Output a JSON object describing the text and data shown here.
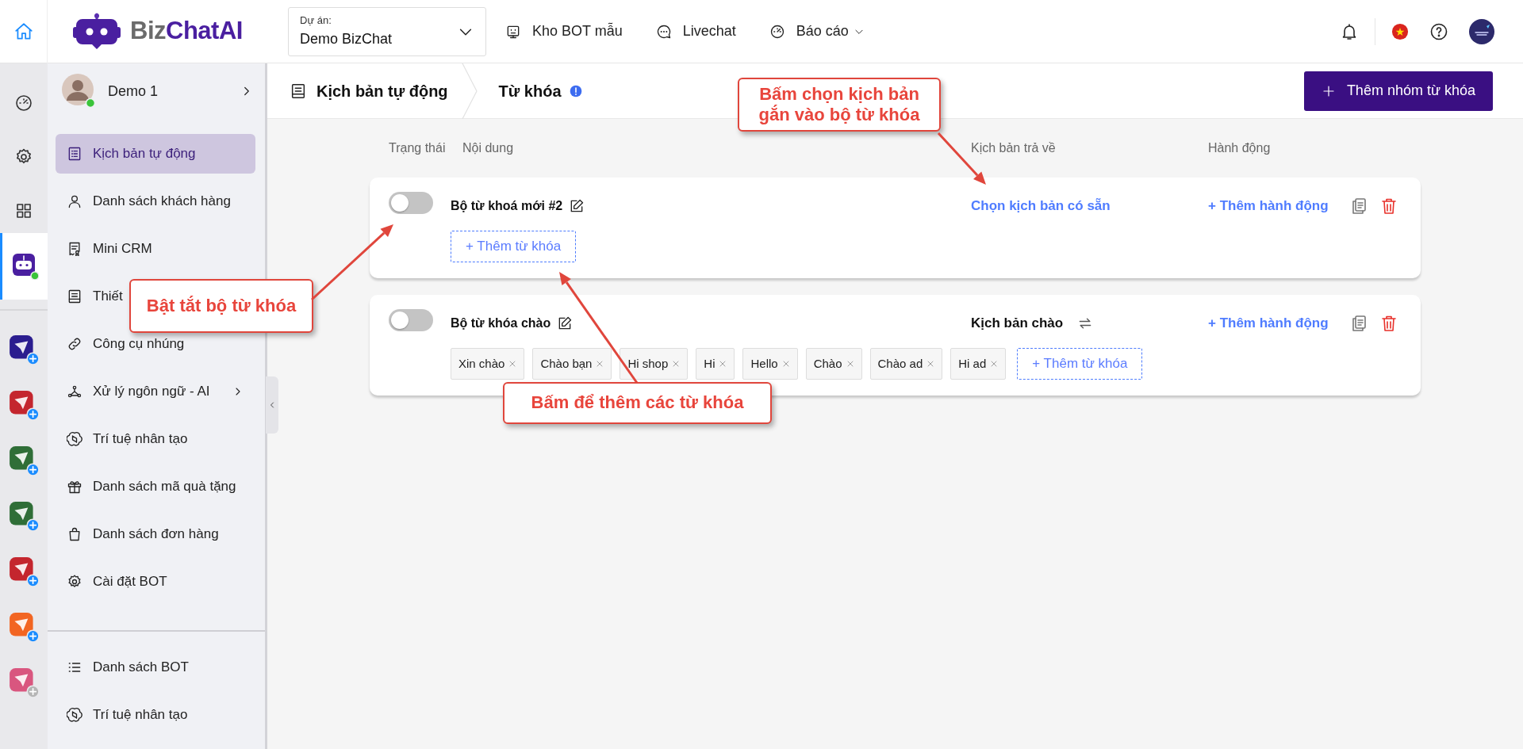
{
  "topbar": {
    "brand": {
      "prefix": "Biz",
      "name": "ChatAI"
    },
    "project": {
      "label": "Dự án:",
      "value": "Demo BizChat"
    },
    "nav": [
      {
        "label": "Kho BOT mẫu",
        "dropdown": false
      },
      {
        "label": "Livechat",
        "dropdown": false
      },
      {
        "label": "Báo cáo",
        "dropdown": true
      }
    ]
  },
  "rail": {
    "tools": [
      {
        "selected": false
      },
      {
        "selected": false
      },
      {
        "selected": false
      },
      {
        "selected": true,
        "online": true
      }
    ],
    "apps": [
      {
        "color": "#2b1d8f",
        "enabled": true
      },
      {
        "color": "#c4262e",
        "enabled": true
      },
      {
        "color": "#2f6e37",
        "enabled": true
      },
      {
        "color": "#2f6e37",
        "enabled": true
      },
      {
        "color": "#c4262e",
        "enabled": true
      },
      {
        "color": "#f26522",
        "enabled": true
      },
      {
        "color": "#d9567f",
        "enabled": false
      }
    ]
  },
  "sidebar": {
    "user": {
      "name": "Demo 1",
      "online": true
    },
    "items": [
      {
        "label": "Kịch bản tự động",
        "selected": true,
        "submenu": false
      },
      {
        "label": "Danh sách khách hàng",
        "selected": false,
        "submenu": false
      },
      {
        "label": "Mini CRM",
        "selected": false,
        "submenu": false
      },
      {
        "label": "Thiết",
        "selected": false,
        "submenu": false
      },
      {
        "label": "Công cụ nhúng",
        "selected": false,
        "submenu": false
      },
      {
        "label": "Xử lý ngôn ngữ - AI",
        "selected": false,
        "submenu": true
      },
      {
        "label": "Trí tuệ nhân tạo",
        "selected": false,
        "submenu": false
      },
      {
        "label": "Danh sách mã quà tặng",
        "selected": false,
        "submenu": false
      },
      {
        "label": "Danh sách đơn hàng",
        "selected": false,
        "submenu": false
      },
      {
        "label": "Cài đặt BOT",
        "selected": false,
        "submenu": false
      }
    ],
    "bottom_items": [
      {
        "label": "Danh sách BOT",
        "selected": false
      },
      {
        "label": "Trí tuệ nhân tạo",
        "selected": false
      }
    ]
  },
  "breadcrumb": [
    {
      "label": "Kịch bản tự động"
    },
    {
      "label": "Từ khóa"
    }
  ],
  "add_group_button": "Thêm nhóm từ khóa",
  "table": {
    "columns": [
      "Trạng thái",
      "Nội dung",
      "Kịch bản trả về",
      "Hành động"
    ],
    "rows": [
      {
        "name": "Bộ từ khoá mới #2",
        "enabled": false,
        "keywords": [],
        "add_keyword": "+ Thêm từ khóa",
        "script": {
          "kind": "choose",
          "label": "Chọn kịch bản có sẵn"
        },
        "action": "+ Thêm hành động"
      },
      {
        "name": "Bộ từ khóa chào",
        "enabled": false,
        "keywords": [
          "Xin chào",
          "Chào bạn",
          "Hi shop",
          "Hi",
          "Hello",
          "Chào",
          "Chào ad",
          "Hi ad"
        ],
        "add_keyword": "+ Thêm từ khóa",
        "script": {
          "kind": "assigned",
          "label": "Kịch bản chào"
        },
        "action": "+ Thêm hành động"
      }
    ]
  },
  "annotations": [
    {
      "text": "Bấm chọn kịch bản gắn vào bộ từ khóa"
    },
    {
      "text": "Bật tắt bộ từ khóa"
    },
    {
      "text": "Bấm để thêm các từ khóa"
    }
  ]
}
